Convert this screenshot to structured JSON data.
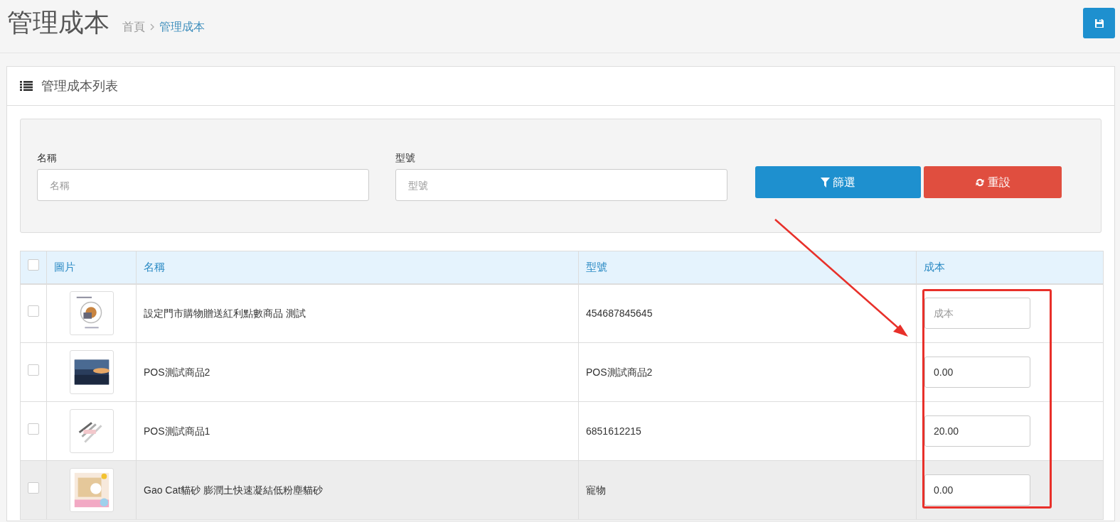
{
  "page_header": {
    "title": "管理成本",
    "breadcrumb": [
      "首頁",
      "管理成本"
    ]
  },
  "panel": {
    "title": "管理成本列表"
  },
  "filters": [
    {
      "label": "名稱",
      "placeholder": "名稱"
    },
    {
      "label": "型號",
      "placeholder": "型號"
    }
  ],
  "filter_buttons": [
    {
      "kind": "filter",
      "label": "篩選"
    },
    {
      "kind": "reset",
      "label": "重設"
    }
  ],
  "table": {
    "select_all": {
      "checked": false
    },
    "columns": [
      "圖片",
      "名稱",
      "型號",
      "成本"
    ],
    "rows": [
      {
        "checked": false,
        "highlighted": false,
        "name": "設定門市購物贈送紅利點數商品 測試",
        "model": "454687845645",
        "cost": {
          "placeholder": "成本"
        }
      },
      {
        "checked": false,
        "highlighted": false,
        "name": "POS測試商品2",
        "model": "POS測試商品2",
        "cost": {
          "value": "0.00"
        }
      },
      {
        "checked": false,
        "highlighted": false,
        "name": "POS測試商品1",
        "model": "6851612215",
        "cost": {
          "value": "20.00"
        }
      },
      {
        "checked": false,
        "highlighted": true,
        "name": "Gao Cat貓砂 膨潤土快速凝結低粉塵貓砂",
        "model": "寵物",
        "cost": {
          "value": "0.00"
        }
      }
    ]
  }
}
